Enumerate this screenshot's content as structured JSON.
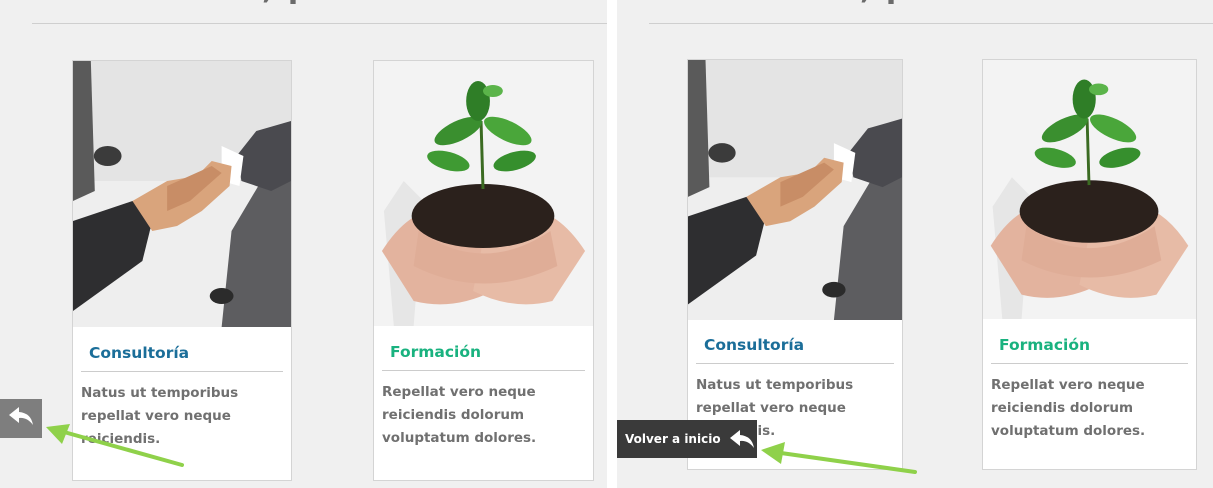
{
  "left_view": {
    "cards": [
      {
        "title": "Consultoría",
        "description": "Natus ut temporibus repellat vero neque reiciendis.",
        "image": "handshake-photo",
        "title_color": "#1b6e99"
      },
      {
        "title": "Formación",
        "description": "Repellat vero neque reiciendis dolorum voluptatum dolores.",
        "image": "plant-in-hands-photo",
        "title_color": "#19b27f"
      }
    ],
    "back_button": {
      "icon": "reply-arrow-icon"
    }
  },
  "right_view": {
    "cards": [
      {
        "title": "Consultoría",
        "description": "Natus ut temporibus repellat vero neque reiciendis.",
        "image": "handshake-photo",
        "title_color": "#1b6e99"
      },
      {
        "title": "Formación",
        "description": "Repellat vero neque reiciendis dolorum voluptatum dolores.",
        "image": "plant-in-hands-photo",
        "title_color": "#19b27f"
      }
    ],
    "back_button": {
      "label": "Volver a inicio",
      "icon": "reply-arrow-icon"
    }
  },
  "annotation": {
    "arrow_color": "#8fd14a"
  }
}
